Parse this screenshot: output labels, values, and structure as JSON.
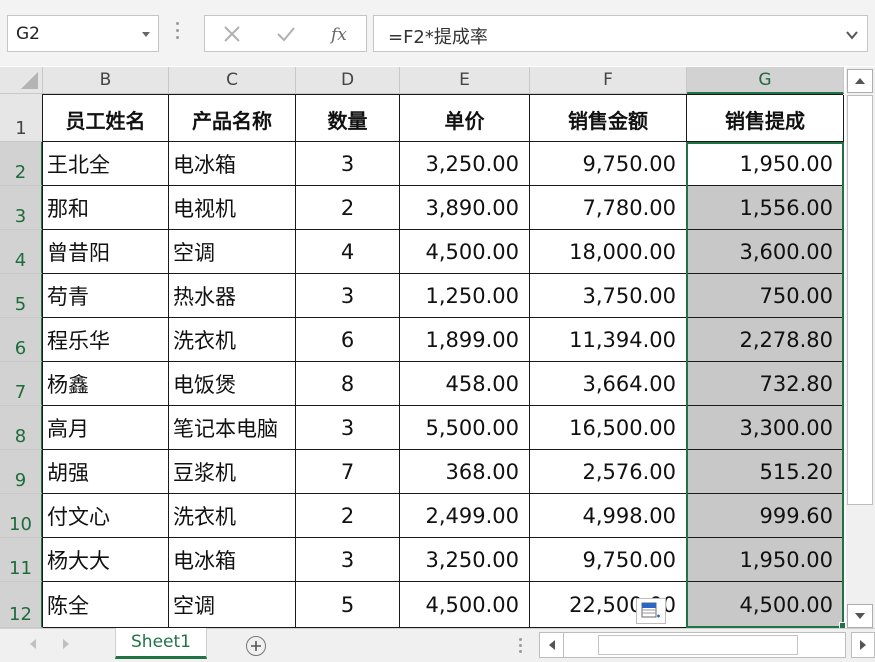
{
  "formula_bar": {
    "name_box": "G2",
    "formula": "=F2*提成率",
    "cancel_icon": "close-icon",
    "enter_icon": "checkmark-icon",
    "function_icon": "fx-icon"
  },
  "columns": [
    "B",
    "C",
    "D",
    "E",
    "F",
    "G"
  ],
  "selected_column": "G",
  "rows": [
    "1",
    "2",
    "3",
    "4",
    "5",
    "6",
    "7",
    "8",
    "9",
    "10",
    "11",
    "12"
  ],
  "table": {
    "headers": [
      "员工姓名",
      "产品名称",
      "数量",
      "单价",
      "销售金额",
      "销售提成"
    ],
    "data": [
      [
        "王北全",
        "电冰箱",
        "3",
        "3,250.00",
        "9,750.00",
        "1,950.00"
      ],
      [
        "那和",
        "电视机",
        "2",
        "3,890.00",
        "7,780.00",
        "1,556.00"
      ],
      [
        "曾昔阳",
        "空调",
        "4",
        "4,500.00",
        "18,000.00",
        "3,600.00"
      ],
      [
        "苟青",
        "热水器",
        "3",
        "1,250.00",
        "3,750.00",
        "750.00"
      ],
      [
        "程乐华",
        "洗衣机",
        "6",
        "1,899.00",
        "11,394.00",
        "2,278.80"
      ],
      [
        "杨鑫",
        "电饭煲",
        "8",
        "458.00",
        "3,664.00",
        "732.80"
      ],
      [
        "高月",
        "笔记本电脑",
        "3",
        "5,500.00",
        "16,500.00",
        "3,300.00"
      ],
      [
        "胡强",
        "豆浆机",
        "7",
        "368.00",
        "2,576.00",
        "515.20"
      ],
      [
        "付文心",
        "洗衣机",
        "2",
        "2,499.00",
        "4,998.00",
        "999.60"
      ],
      [
        "杨大大",
        "电冰箱",
        "3",
        "3,250.00",
        "9,750.00",
        "1,950.00"
      ],
      [
        "陈全",
        "空调",
        "5",
        "4,500.00",
        "22,500.00",
        "4,500.00"
      ]
    ]
  },
  "sheet_tabs": [
    "Sheet1"
  ],
  "active_sheet": "Sheet1",
  "colors": {
    "accent": "#217346",
    "selection_fill": "#c8c8c8"
  }
}
